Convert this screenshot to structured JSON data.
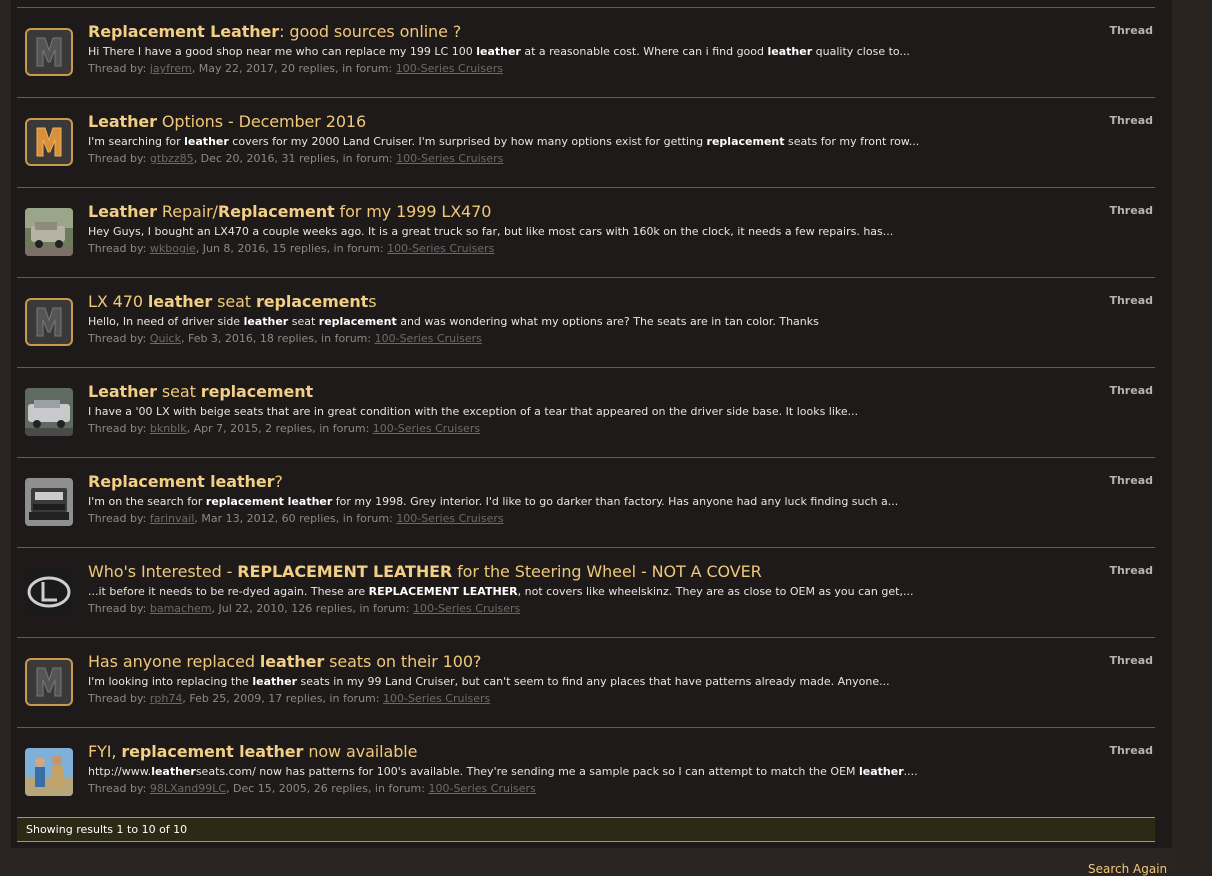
{
  "results": [
    {
      "title_parts": [
        [
          "Replacement Leather",
          true
        ],
        [
          ": good sources online ?",
          false
        ]
      ],
      "snippet_parts": [
        [
          "Hi There I have a good shop near me who can replace my 199 LC 100 ",
          false
        ],
        [
          "leather",
          true
        ],
        [
          " at a reasonable cost. Where can i find good ",
          false
        ],
        [
          "leather",
          true
        ],
        [
          " quality close to...",
          false
        ]
      ],
      "user": "jayfrem",
      "date": "May 22, 2017",
      "replies": "20 replies",
      "forum": "100-Series Cruisers",
      "type": "Thread",
      "avatar": "logo"
    },
    {
      "title_parts": [
        [
          "Leather",
          true
        ],
        [
          " Options - December 2016",
          false
        ]
      ],
      "snippet_parts": [
        [
          "I'm searching for ",
          false
        ],
        [
          "leather",
          true
        ],
        [
          " covers for my 2000 Land Cruiser. I'm surprised by how many options exist for getting ",
          false
        ],
        [
          "replacement",
          true
        ],
        [
          " seats for my front row...",
          false
        ]
      ],
      "user": "gtbzz85",
      "date": "Dec 20, 2016",
      "replies": "31 replies",
      "forum": "100-Series Cruisers",
      "type": "Thread",
      "avatar": "logo-orange"
    },
    {
      "title_parts": [
        [
          "Leather",
          true
        ],
        [
          " Repair/",
          false
        ],
        [
          "Replacement",
          true
        ],
        [
          " for my 1999 LX470",
          false
        ]
      ],
      "snippet_parts": [
        [
          "Hey Guys, I bought an LX470 a couple weeks ago. It is a great truck so far, but like most cars with 160k on the clock, it needs a few repairs. has...",
          false
        ]
      ],
      "user": "wkbogie",
      "date": "Jun 8, 2016",
      "replies": "15 replies",
      "forum": "100-Series Cruisers",
      "type": "Thread",
      "avatar": "photo-suv-forest"
    },
    {
      "title_parts": [
        [
          "LX 470 ",
          false
        ],
        [
          "leather",
          true
        ],
        [
          " seat ",
          false
        ],
        [
          "replacement",
          true
        ],
        [
          "s",
          false
        ]
      ],
      "snippet_parts": [
        [
          "Hello, In need of driver side ",
          false
        ],
        [
          "leather",
          true
        ],
        [
          " seat ",
          false
        ],
        [
          "replacement",
          true
        ],
        [
          " and was wondering what my options are? The seats are in tan color. Thanks",
          false
        ]
      ],
      "user": "Quick",
      "date": "Feb 3, 2016",
      "replies": "18 replies",
      "forum": "100-Series Cruisers",
      "type": "Thread",
      "avatar": "logo"
    },
    {
      "title_parts": [
        [
          "Leather",
          true
        ],
        [
          " seat ",
          false
        ],
        [
          "replacement",
          true
        ]
      ],
      "snippet_parts": [
        [
          "I have a '00 LX with beige seats that are in great condition with the exception of a tear that appeared on the driver side base. It looks like...",
          false
        ]
      ],
      "user": "bknblk",
      "date": "Apr 7, 2015",
      "replies": "2 replies",
      "forum": "100-Series Cruisers",
      "type": "Thread",
      "avatar": "photo-suv-silver"
    },
    {
      "title_parts": [
        [
          "Replacement leather",
          true
        ],
        [
          "?",
          false
        ]
      ],
      "snippet_parts": [
        [
          "I'm on the search for ",
          false
        ],
        [
          "replacement leather",
          true
        ],
        [
          " for my 1998. Grey interior. I'd like to go darker than factory. Has anyone had any luck finding such a...",
          false
        ]
      ],
      "user": "farinvail",
      "date": "Mar 13, 2012",
      "replies": "60 replies",
      "forum": "100-Series Cruisers",
      "type": "Thread",
      "avatar": "photo-suv-front"
    },
    {
      "title_parts": [
        [
          "Who's Interested - ",
          false
        ],
        [
          "REPLACEMENT LEATHER",
          true
        ],
        [
          " for the Steering Wheel - NOT A COVER",
          false
        ]
      ],
      "snippet_parts": [
        [
          "...it before it needs to be re-dyed again. These are ",
          false
        ],
        [
          "REPLACEMENT LEATHER",
          true
        ],
        [
          ", not covers like wheelskinz. They are as close to OEM as you can get,...",
          false
        ]
      ],
      "user": "bamachem",
      "date": "Jul 22, 2010",
      "replies": "126 replies",
      "forum": "100-Series Cruisers",
      "type": "Thread",
      "avatar": "photo-lexus-emblem"
    },
    {
      "title_parts": [
        [
          "Has anyone replaced ",
          false
        ],
        [
          "leather",
          true
        ],
        [
          " seats on their 100?",
          false
        ]
      ],
      "snippet_parts": [
        [
          "I'm looking into replacing the ",
          false
        ],
        [
          "leather",
          true
        ],
        [
          " seats in my 99 Land Cruiser, but can't seem to find any places that have patterns already made. Anyone...",
          false
        ]
      ],
      "user": "rph74",
      "date": "Feb 25, 2009",
      "replies": "17 replies",
      "forum": "100-Series Cruisers",
      "type": "Thread",
      "avatar": "logo"
    },
    {
      "title_parts": [
        [
          "FYI, ",
          false
        ],
        [
          "replacement leather",
          true
        ],
        [
          " now available",
          false
        ]
      ],
      "snippet_parts": [
        [
          "http://www.",
          false
        ],
        [
          "leather",
          true
        ],
        [
          "seats.com/ now has patterns for 100's available. They're sending me a sample pack so I can attempt to match the OEM ",
          false
        ],
        [
          "leather",
          true
        ],
        [
          "....",
          false
        ]
      ],
      "user": "98LXand99LC",
      "date": "Dec 15, 2005",
      "replies": "26 replies",
      "forum": "100-Series Cruisers",
      "type": "Thread",
      "avatar": "photo-people"
    }
  ],
  "labels": {
    "thread_by": "Thread by: ",
    "in_forum": ", in forum: "
  },
  "footer": {
    "showing": "Showing results 1 to 10 of 10"
  },
  "search_again": "Search Again",
  "colors": {
    "accent": "#f0c878",
    "border": "#7a5a2a",
    "panel": "#1e1a19",
    "background": "#2a2422"
  }
}
